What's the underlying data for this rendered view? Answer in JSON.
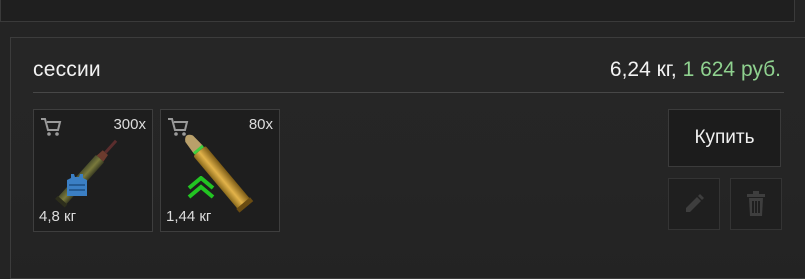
{
  "section": {
    "title": "сессии",
    "weight_total": "6,24 кг,",
    "price_total": "1 624 руб."
  },
  "items": [
    {
      "count": "300x",
      "weight": "4,8 кг",
      "badge_icon": "body-armor-icon",
      "icon": "cart-icon"
    },
    {
      "count": "80x",
      "weight": "1,44 кг",
      "badge_icon": "rank-chevron-up-icon",
      "icon": "cart-icon"
    }
  ],
  "actions": {
    "buy_label": "Купить",
    "edit_icon": "pencil-icon",
    "delete_icon": "trash-icon"
  },
  "colors": {
    "price": "#8fd18f",
    "badge_green": "#22c422",
    "badge_blue": "#3b7fc4"
  }
}
